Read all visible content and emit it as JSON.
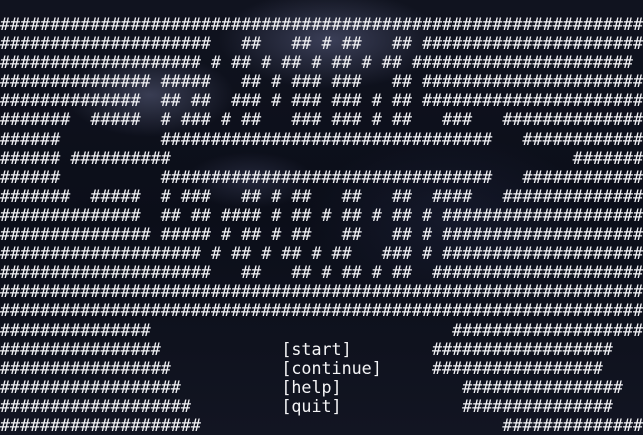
{
  "art_lines": [
    "################################################################",
    "#####################   ##   ## # ##   ## ######################",
    "#################### # ## # ## # ## # ## ######################",
    "############### #####   ## # ### ###   ## ######################",
    "##############  ## ##  ### # ### ### # ## ######################",
    "#######  #####  # ### # ##   ### ### # ##   ###   ##############",
    "######          #################################   ############",
    "###### ##########                                        #######",
    "######          #################################   ############",
    "#######  #####  # ###   ## # ##   ##   ##  ####   ##############",
    "##############  ## ## #### # ## # ## # ## # ####################",
    "############### ##### # ## # ##   ##   ## # ####################",
    "#################### # ## # ## # ##   ### # ####################",
    "#####################   ##   ## # ## # ##  #####################",
    "################################################################",
    "################################################################",
    "###############                              ###################"
  ],
  "menu_rows": [
    {
      "left": "################",
      "gap": "            ",
      "suffix": "        ",
      "right": "##################"
    },
    {
      "left": "#################",
      "gap": "           ",
      "suffix": "     ",
      "right": "#################"
    },
    {
      "left": "##################",
      "gap": "          ",
      "suffix": "            ",
      "right": "################"
    },
    {
      "left": "###################",
      "gap": "         ",
      "suffix": "            ",
      "right": "###############"
    },
    {
      "left": "####################",
      "gap": "",
      "suffix": "",
      "right": "##############"
    }
  ],
  "menu": {
    "start": "[start]",
    "continue": "[continue]",
    "help": "[help]",
    "quit": "[quit]",
    "empty": "                              "
  },
  "bottom_line": "################################################################"
}
